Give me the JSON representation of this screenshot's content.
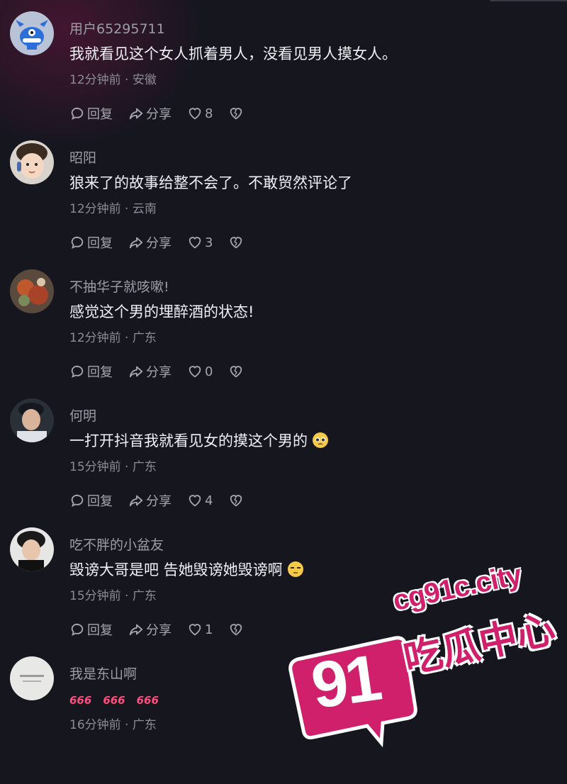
{
  "comments": [
    {
      "username": "用户65295711",
      "text": "我就看见这个女人抓着男人，没看见男人摸女人。",
      "time": "12分钟前",
      "location": "安徽",
      "reply_label": "回复",
      "share_label": "分享",
      "likes": "8",
      "emoji": ""
    },
    {
      "username": "昭阳",
      "text": "狼来了的故事给整不会了。不敢贸然评论了",
      "time": "12分钟前",
      "location": "云南",
      "reply_label": "回复",
      "share_label": "分享",
      "likes": "3",
      "emoji": ""
    },
    {
      "username": "不抽华子就咳嗽!",
      "text": "感觉这个男的埋醉酒的状态!",
      "time": "12分钟前",
      "location": "广东",
      "reply_label": "回复",
      "share_label": "分享",
      "likes": "0",
      "emoji": ""
    },
    {
      "username": "何明",
      "text": "一打开抖音我就看见女的摸这个男的",
      "time": "15分钟前",
      "location": "广东",
      "reply_label": "回复",
      "share_label": "分享",
      "likes": "4",
      "emoji": "pleading-face-emoji"
    },
    {
      "username": "吃不胖的小盆友",
      "text": "毁谤大哥是吧 告她毁谤她毁谤啊",
      "time": "15分钟前",
      "location": "广东",
      "reply_label": "回复",
      "share_label": "分享",
      "likes": "1",
      "emoji": "unamused-face-emoji"
    },
    {
      "username": "我是东山啊",
      "text": "",
      "tags": [
        "666",
        "666",
        "666"
      ],
      "time": "16分钟前",
      "location": "广东"
    }
  ],
  "separator": "·",
  "watermark": {
    "number": "91",
    "domain": "cg91c.city",
    "name": "吃瓜中心",
    "color": "#d0206b"
  },
  "colors": {
    "background": "#16161f",
    "text": "#f0f0f4",
    "muted": "#8c8c95",
    "accent": "#ff4d7e"
  }
}
